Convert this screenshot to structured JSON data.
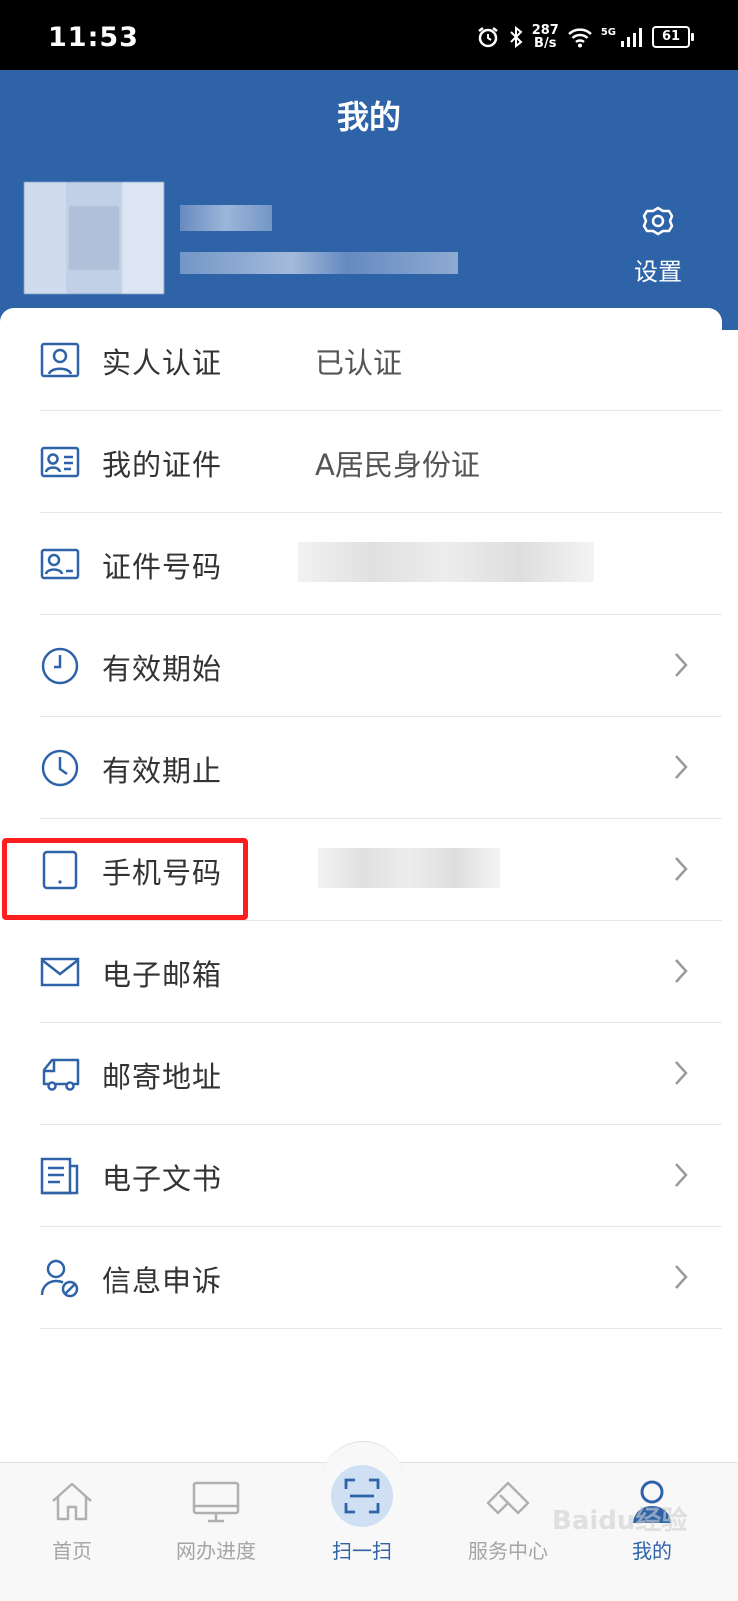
{
  "status_bar": {
    "time": "11:53",
    "net_speed_value": "287",
    "net_speed_unit": "B/s",
    "network_type": "5G",
    "battery": "61"
  },
  "header": {
    "title": "我的",
    "settings_label": "设置"
  },
  "menu": [
    {
      "label": "实人认证",
      "value": "已认证",
      "icon": "person-card-icon"
    },
    {
      "label": "我的证件",
      "value": "A居民身份证",
      "icon": "id-card-icon"
    },
    {
      "label": "证件号码",
      "value": "",
      "icon": "id-number-icon"
    },
    {
      "label": "有效期始",
      "value": "",
      "icon": "clock-icon"
    },
    {
      "label": "有效期止",
      "value": "",
      "icon": "clock-icon"
    },
    {
      "label": "手机号码",
      "value": "",
      "icon": "phone-icon"
    },
    {
      "label": "电子邮箱",
      "value": "",
      "icon": "mail-icon"
    },
    {
      "label": "邮寄地址",
      "value": "",
      "icon": "truck-icon"
    },
    {
      "label": "电子文书",
      "value": "",
      "icon": "document-icon"
    },
    {
      "label": "信息申诉",
      "value": "",
      "icon": "user-appeal-icon"
    }
  ],
  "bottom_nav": [
    {
      "label": "首页",
      "icon": "home-icon"
    },
    {
      "label": "网办进度",
      "icon": "monitor-icon"
    },
    {
      "label": "扫一扫",
      "icon": "scan-icon"
    },
    {
      "label": "服务中心",
      "icon": "service-icon"
    },
    {
      "label": "我的",
      "icon": "profile-icon",
      "active": true
    }
  ],
  "colors": {
    "primary": "#2f63a8",
    "highlight": "#ff1d1d"
  },
  "watermark": "Baidu经验"
}
